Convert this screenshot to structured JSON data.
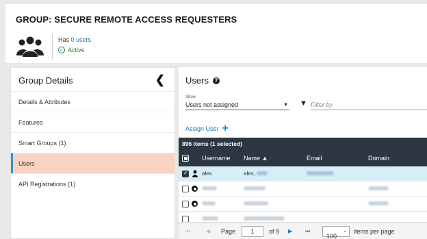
{
  "header": {
    "title": "GROUP: SECURE REMOTE ACCESS REQUESTERS",
    "has_prefix": "Has",
    "users_link": "0 users",
    "status": "Active",
    "status_color": "#2e7d32"
  },
  "sidebar": {
    "title": "Group Details",
    "collapse_icon": "chevron-left-icon",
    "items": [
      {
        "label": "Details & Attributes"
      },
      {
        "label": "Features"
      },
      {
        "label": "Smart Groups (1)"
      },
      {
        "label": "Users",
        "active": true
      },
      {
        "label": "API Registrations (1)"
      }
    ]
  },
  "main": {
    "title": "Users",
    "show_label": "Show",
    "show_value": "Users not assigned",
    "filter_placeholder": "Filter by",
    "assign_label": "Assign User",
    "table": {
      "summary": "896 items (1 selected)",
      "columns": [
        "Username",
        "Name ▲",
        "Email",
        "Domain"
      ],
      "first_row": {
        "username": "alex",
        "name": "alex,"
      }
    },
    "pager": {
      "page_label": "Page",
      "page_value": "1",
      "of_label": "of 9",
      "per_page_value": "100",
      "per_page_label": "items per page"
    }
  },
  "colors": {
    "accent": "#1a7ab8",
    "table_header": "#2c3742",
    "active_nav": "#fbd3c3",
    "selected_row": "#d7eef8"
  }
}
